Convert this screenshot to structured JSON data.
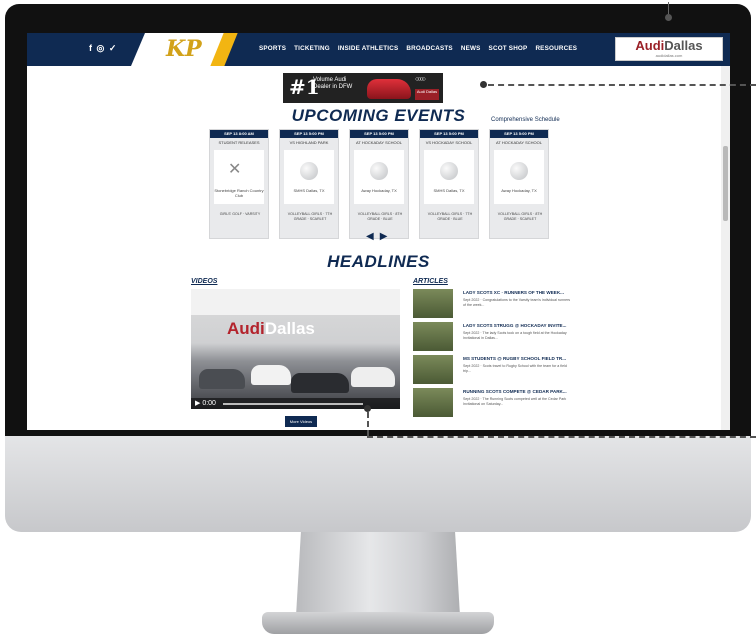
{
  "site": {
    "social_icons": "f ◎ ✓",
    "logo_text": "KP",
    "menu": [
      "SPORTS",
      "TICKETING",
      "INSIDE ATHLETICS",
      "BROADCASTS",
      "NEWS",
      "SCOT SHOP",
      "RESOURCES"
    ],
    "sponsor": {
      "name_a": "Audi",
      "name_b": "Dallas",
      "url": "audidallas.com"
    }
  },
  "ad": {
    "number": "#1",
    "line1": "Volume Audi",
    "line2": "Dealer in DFW",
    "brand": "Audi Dallas"
  },
  "events": {
    "title": "UPCOMING EVENTS",
    "schedule_link": "Comprehensive Schedule",
    "cards": [
      {
        "date": "SEP 13 8:00 AM",
        "opponent": "STUDENT RELEASES",
        "icon": "golf-clubs-icon",
        "venue": "Stonebridge Ranch Country Club",
        "info": "GIRLS' GOLF · VARSITY"
      },
      {
        "date": "SEP 13 5:00 PM",
        "opponent": "VS HIGHLAND PARK",
        "icon": "volleyball-icon",
        "venue": "SMHS Dallas, TX",
        "info": "VOLLEYBALL GIRLS · 7TH GRADE · SCARLET"
      },
      {
        "date": "SEP 13 5:00 PM",
        "opponent": "AT HOCKADAY SCHOOL",
        "icon": "volleyball-icon",
        "venue": "Away Hockaday, TX",
        "info": "VOLLEYBALL GIRLS · 8TH GRADE · BLUE"
      },
      {
        "date": "SEP 13 5:00 PM",
        "opponent": "VS HOCKADAY SCHOOL",
        "icon": "volleyball-icon",
        "venue": "SMHS Dallas, TX",
        "info": "VOLLEYBALL GIRLS · 7TH GRADE · BLUE"
      },
      {
        "date": "SEP 13 5:00 PM",
        "opponent": "AT HOCKADAY SCHOOL",
        "icon": "volleyball-icon",
        "venue": "Away Hockaday, TX",
        "info": "VOLLEYBALL GIRLS · 8TH GRADE · SCARLET"
      }
    ]
  },
  "headlines": {
    "title": "HEADLINES",
    "videos_label": "VIDEOS",
    "news_label": "ARTICLES",
    "video_brand_a": "Audi",
    "video_brand_b": "Dallas",
    "video_time": "0:00",
    "more_videos": "More Videos",
    "articles": [
      {
        "head": "LADY SCOTS XC · RUNNERS OF THE WEEK...",
        "sub": "Sept 2022 · Congratulations to the Varsity team's individual runners of the week..."
      },
      {
        "head": "LADY SCOTS STRUGG @ HOCKADAY INVITE...",
        "sub": "Sept 2022 · The lady Scots took on a tough field at the Hockaday Invitational in Dallas..."
      },
      {
        "head": "MS STUDENTS @ RUGBY SCHOOL FIELD TR...",
        "sub": "Sept 2022 · Scots travel to Rugby School with the team for a field trip..."
      },
      {
        "head": "RUNNING SCOTS COMPETE @ CEDAR PARK...",
        "sub": "Sept 2022 · The Running Scots competed well at the Cedar Park Invitational on Saturday..."
      }
    ]
  }
}
